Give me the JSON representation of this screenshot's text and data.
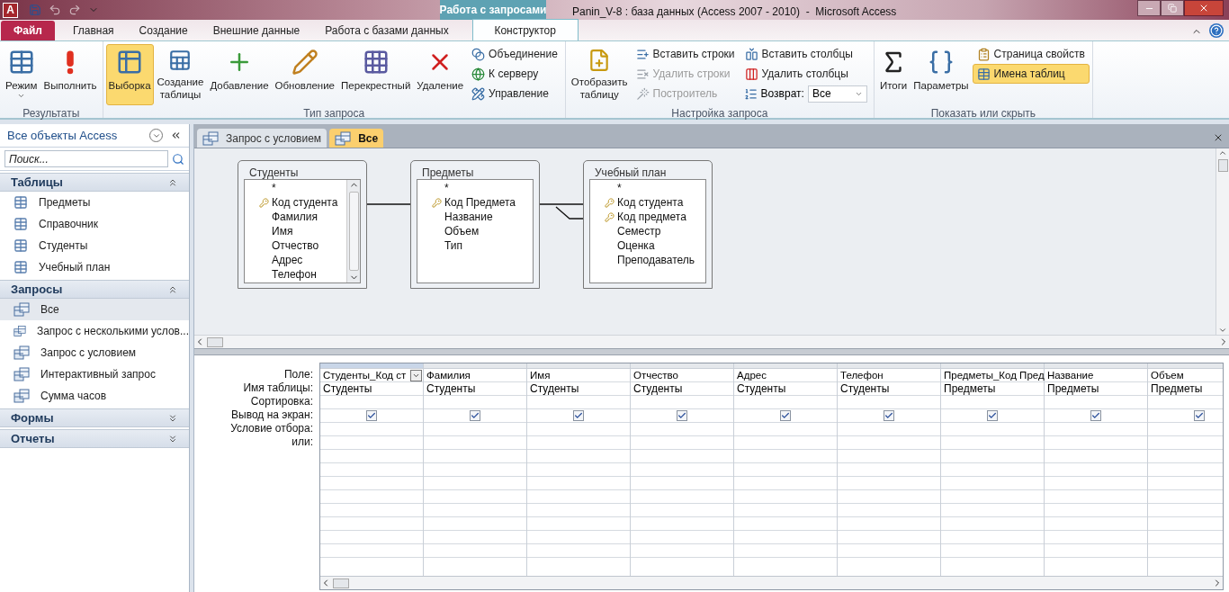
{
  "window": {
    "app_logo": "A",
    "title": "Panin_V-8 : база данных (Access 2007 - 2010)  -  Microsoft Access",
    "contextual_tab": "Работа с запросами"
  },
  "ribbon_tabs": [
    {
      "label": "Файл",
      "kind": "file",
      "selected": false
    },
    {
      "label": "Главная",
      "kind": "tab",
      "selected": false
    },
    {
      "label": "Создание",
      "kind": "tab",
      "selected": false
    },
    {
      "label": "Внешние данные",
      "kind": "tab",
      "selected": false
    },
    {
      "label": "Работа с базами данных",
      "kind": "tab",
      "selected": false
    },
    {
      "label": "Конструктор",
      "kind": "contextual",
      "selected": true
    }
  ],
  "ribbon_groups": [
    {
      "title": "Результаты",
      "items": [
        {
          "label": "Режим",
          "kind": "split",
          "selected": false,
          "disabled": false
        },
        {
          "label": "Выполнить",
          "kind": "large",
          "selected": false,
          "disabled": false
        }
      ]
    },
    {
      "title": "Тип запроса",
      "items": [
        {
          "label": "Выборка",
          "kind": "large",
          "selected": true,
          "disabled": false
        },
        {
          "label": "Создание таблицы",
          "kind": "large",
          "selected": false,
          "disabled": false
        },
        {
          "label": "Добавление",
          "kind": "large",
          "selected": false,
          "disabled": false
        },
        {
          "label": "Обновление",
          "kind": "large",
          "selected": false,
          "disabled": false
        },
        {
          "label": "Перекрестный",
          "kind": "large",
          "selected": false,
          "disabled": false
        },
        {
          "label": "Удаление",
          "kind": "large",
          "selected": false,
          "disabled": false
        },
        {
          "label": "Объединение",
          "kind": "small",
          "selected": false,
          "disabled": false
        },
        {
          "label": "К серверу",
          "kind": "small",
          "selected": false,
          "disabled": false
        },
        {
          "label": "Управление",
          "kind": "small",
          "selected": false,
          "disabled": false
        }
      ]
    },
    {
      "title": "Настройка запроса",
      "items": [
        {
          "label": "Отобразить таблицу",
          "kind": "large",
          "selected": false,
          "disabled": false
        },
        {
          "label": "Вставить строки",
          "kind": "small",
          "selected": false,
          "disabled": false
        },
        {
          "label": "Удалить строки",
          "kind": "small",
          "selected": false,
          "disabled": true
        },
        {
          "label": "Построитель",
          "kind": "small",
          "selected": false,
          "disabled": true
        },
        {
          "label": "Вставить столбцы",
          "kind": "small",
          "selected": false,
          "disabled": false
        },
        {
          "label": "Удалить столбцы",
          "kind": "small",
          "selected": false,
          "disabled": false
        },
        {
          "label": "Возврат:",
          "kind": "dropdown",
          "value": "Все"
        }
      ]
    },
    {
      "title": "Показать или скрыть",
      "items": [
        {
          "label": "Итоги",
          "kind": "large",
          "selected": false,
          "disabled": false
        },
        {
          "label": "Параметры",
          "kind": "large",
          "selected": false,
          "disabled": false
        },
        {
          "label": "Страница свойств",
          "kind": "small",
          "selected": false,
          "disabled": false
        },
        {
          "label": "Имена таблиц",
          "kind": "small",
          "selected": true,
          "disabled": false
        }
      ]
    }
  ],
  "navigation": {
    "title": "Все объекты Access",
    "search": {
      "placeholder": "Поиск..."
    },
    "sections": [
      {
        "title": "Таблицы",
        "kind": "table",
        "expanded": true,
        "items": [
          {
            "label": "Предметы",
            "selected": false
          },
          {
            "label": "Справочник",
            "selected": false
          },
          {
            "label": "Студенты",
            "selected": false
          },
          {
            "label": "Учебный план",
            "selected": false
          }
        ]
      },
      {
        "title": "Запросы",
        "kind": "query",
        "expanded": true,
        "items": [
          {
            "label": "Все",
            "selected": true
          },
          {
            "label": "Запрос с несколькими услов...",
            "selected": false
          },
          {
            "label": "Запрос с условием",
            "selected": false
          },
          {
            "label": "Интерактивный запрос",
            "selected": false
          },
          {
            "label": "Сумма часов",
            "selected": false
          }
        ]
      },
      {
        "title": "Формы",
        "expanded": false
      },
      {
        "title": "Отчеты",
        "expanded": false
      }
    ]
  },
  "document_tabs": [
    {
      "label": "Запрос с условием",
      "selected": false
    },
    {
      "label": "Все",
      "selected": true
    }
  ],
  "diagram": {
    "tables": [
      {
        "title": "Студенты",
        "scrollbar": true,
        "fields": [
          {
            "name": "*",
            "key": false
          },
          {
            "name": "Код студента",
            "key": true
          },
          {
            "name": "Фамилия",
            "key": false
          },
          {
            "name": "Имя",
            "key": false
          },
          {
            "name": "Отчество",
            "key": false
          },
          {
            "name": "Адрес",
            "key": false
          },
          {
            "name": "Телефон",
            "key": false
          }
        ]
      },
      {
        "title": "Предметы",
        "scrollbar": false,
        "fields": [
          {
            "name": "*",
            "key": false
          },
          {
            "name": "Код Предмета",
            "key": true
          },
          {
            "name": "Название",
            "key": false
          },
          {
            "name": "Объем",
            "key": false
          },
          {
            "name": "Тип",
            "key": false
          }
        ]
      },
      {
        "title": "Учебный план",
        "scrollbar": false,
        "fields": [
          {
            "name": "*",
            "key": false
          },
          {
            "name": "Код студента",
            "key": true
          },
          {
            "name": "Код предмета",
            "key": true
          },
          {
            "name": "Семестр",
            "key": false
          },
          {
            "name": "Оценка",
            "key": false
          },
          {
            "name": "Преподаватель",
            "key": false
          }
        ]
      }
    ]
  },
  "query_grid": {
    "row_labels": [
      "Поле:",
      "Имя таблицы:",
      "Сортировка:",
      "Вывод на экран:",
      "Условие отбора:",
      "или:"
    ],
    "columns": [
      {
        "field": "Студенты_Код ст",
        "table": "Студенты",
        "show": true,
        "selected": true
      },
      {
        "field": "Фамилия",
        "table": "Студенты",
        "show": true,
        "selected": false
      },
      {
        "field": "Имя",
        "table": "Студенты",
        "show": true,
        "selected": false
      },
      {
        "field": "Отчество",
        "table": "Студенты",
        "show": true,
        "selected": false
      },
      {
        "field": "Адрес",
        "table": "Студенты",
        "show": true,
        "selected": false
      },
      {
        "field": "Телефон",
        "table": "Студенты",
        "show": true,
        "selected": false
      },
      {
        "field": "Предметы_Код Пред",
        "table": "Предметы",
        "show": true,
        "selected": false
      },
      {
        "field": "Название",
        "table": "Предметы",
        "show": true,
        "selected": false
      },
      {
        "field": "Объем",
        "table": "Предметы",
        "show": true,
        "selected": false
      }
    ]
  }
}
